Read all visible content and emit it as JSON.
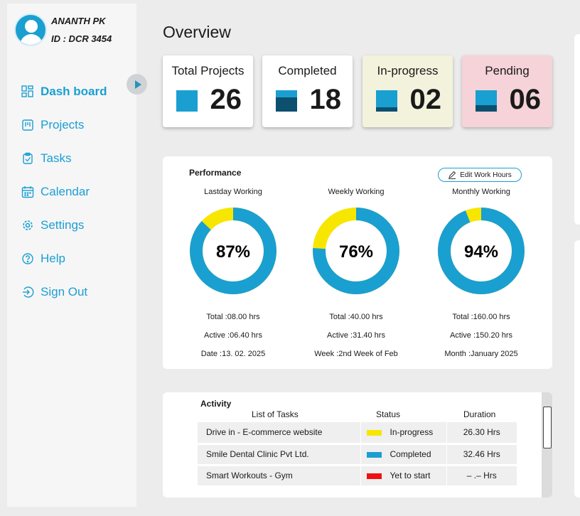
{
  "user": {
    "name": "ANANTH PK",
    "id_label": "ID : DCR 3454"
  },
  "nav": [
    {
      "label": "Dash board",
      "icon": "dashboard-icon",
      "active": true
    },
    {
      "label": "Projects",
      "icon": "projects-icon"
    },
    {
      "label": "Tasks",
      "icon": "tasks-icon"
    },
    {
      "label": "Calendar",
      "icon": "calendar-icon"
    },
    {
      "label": "Settings",
      "icon": "settings-icon"
    },
    {
      "label": "Help",
      "icon": "help-icon"
    },
    {
      "label": "Sign Out",
      "icon": "sign-out-icon"
    }
  ],
  "overview": {
    "title": "Overview"
  },
  "cards": [
    {
      "label": "Total Projects",
      "value": "26",
      "bg": "#ffffff"
    },
    {
      "label": "Completed",
      "value": "18",
      "bg": "#ffffff"
    },
    {
      "label": "In-progress",
      "value": "02",
      "bg": "#f3f2dc"
    },
    {
      "label": "Pending",
      "value": "06",
      "bg": "#f5d3d8"
    }
  ],
  "performance": {
    "title": "Performance",
    "edit_label": "Edit Work Hours",
    "rings": [
      {
        "label": "Lastday Working",
        "percent_text": "87%",
        "fraction": 0.87,
        "total": "Total :08.00 hrs",
        "active": "Active :06.40 hrs",
        "period": "Date :13. 02. 2025"
      },
      {
        "label": "Weekly Working",
        "percent_text": "76%",
        "fraction": 0.76,
        "total": "Total :40.00 hrs",
        "active": "Active :31.40 hrs",
        "period": "Week :2nd Week of Feb"
      },
      {
        "label": "Monthly Working",
        "percent_text": "94%",
        "fraction": 0.94,
        "total": "Total :160.00 hrs",
        "active": "Active :150.20 hrs",
        "period": "Month :January 2025"
      }
    ]
  },
  "activity": {
    "title": "Activity",
    "headers": {
      "tasks": "List of Tasks",
      "status": "Status",
      "duration": "Duration"
    },
    "rows": [
      {
        "task": "Drive in - E-commerce website",
        "status": "In-progress",
        "color": "#f7e600",
        "duration": "26.30 Hrs"
      },
      {
        "task": "Smile Dental Clinic Pvt Ltd.",
        "status": "Completed",
        "color": "#1a9fd1",
        "duration": "32.46 Hrs"
      },
      {
        "task": "Smart Workouts - Gym",
        "status": "Yet to start",
        "color": "#ee1111",
        "duration": "– .–  Hrs"
      }
    ]
  },
  "colors": {
    "accent": "#1a9fd1",
    "ring_remaining": "#f7e600",
    "dark_blue": "#0d4f6e"
  }
}
